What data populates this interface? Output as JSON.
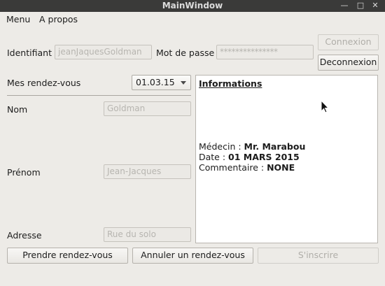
{
  "window": {
    "title": "MainWindow",
    "controls": [
      "minimize-icon",
      "maximize-icon",
      "close-icon"
    ]
  },
  "menubar": {
    "items": [
      {
        "label": "Menu"
      },
      {
        "label": "A propos"
      }
    ]
  },
  "login": {
    "identifiant_label": "Identifiant",
    "identifiant_value": "jeanJaquesGoldman",
    "password_label": "Mot de passe",
    "password_value": "***************",
    "connexion_label": "Connexion",
    "deconnexion_label": "Deconnexion"
  },
  "appointments": {
    "label": "Mes rendez-vous",
    "selected": "01.03.15"
  },
  "profile": {
    "nom_label": "Nom",
    "nom_value": "Goldman",
    "prenom_label": "Prénom",
    "prenom_value": "Jean-Jacques",
    "adresse_label": "Adresse",
    "adresse_value": "Rue du solo"
  },
  "info": {
    "title": "Informations",
    "medecin_label": "Médecin : ",
    "medecin_value": "Mr. Marabou",
    "date_label": "Date : ",
    "date_value": "01 MARS 2015",
    "commentaire_label": "Commentaire : ",
    "commentaire_value": "NONE"
  },
  "actions": {
    "prendre_label": "Prendre rendez-vous",
    "annuler_label": "Annuler un rendez-vous",
    "inscrire_label": "S'inscrire"
  }
}
